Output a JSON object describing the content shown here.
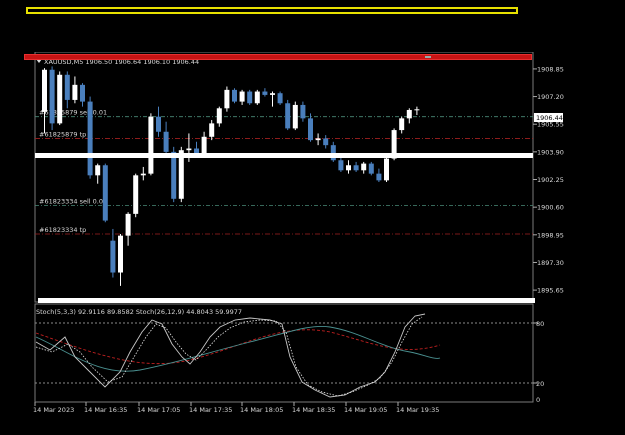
{
  "header": {
    "symbol_line": "XAUUSD,M5  1906.50 1906.64 1906.10 1906.44"
  },
  "price_axis": {
    "ticks": [
      "1908.85",
      "1907.20",
      "1905.55",
      "1903.90",
      "1902.25",
      "1900.60",
      "1898.95",
      "1897.30",
      "1895.65"
    ],
    "current_price": "1906.44"
  },
  "order_lines": [
    {
      "label": "#61825879 sell 0.01",
      "kind": "sell"
    },
    {
      "label": "#61825879 tp",
      "kind": "tp"
    },
    {
      "label": "#61823334 sell 0.01",
      "kind": "sell"
    },
    {
      "label": "#61823334 tp",
      "kind": "tp"
    }
  ],
  "indicator": {
    "label": "Stoch(5,3,3) 92.9116 89.8582  Stoch(26,12,9) 44.8043 59.9977",
    "levels": [
      "80",
      "20",
      "0"
    ]
  },
  "time_axis": [
    "14 Mar 2023",
    "14 Mar 16:35",
    "14 Mar 17:05",
    "14 Mar 17:35",
    "14 Mar 18:05",
    "14 Mar 18:35",
    "14 Mar 19:05",
    "14 Mar 19:35"
  ],
  "colors": {
    "bull": "#ffffff",
    "bear": "#4a7fbd",
    "sell_line": "#4a8a78",
    "tp_line": "#a02020",
    "stoch_fast": "#c8c8c8",
    "stoch_slow_main": "#4a9090",
    "stoch_slow_signal": "#c02020"
  },
  "chart_data": {
    "type": "candlestick",
    "timeframe": "M5",
    "candles_ohlc": [
      [
        1906.3,
        1908.9,
        1905.0,
        1908.8
      ],
      [
        1908.8,
        1909.0,
        1905.2,
        1905.6
      ],
      [
        1905.6,
        1908.7,
        1905.5,
        1908.5
      ],
      [
        1908.5,
        1908.7,
        1906.5,
        1907.0
      ],
      [
        1907.0,
        1908.4,
        1906.8,
        1907.9
      ],
      [
        1907.9,
        1908.0,
        1906.6,
        1906.9
      ],
      [
        1906.9,
        1907.2,
        1902.3,
        1902.5
      ],
      [
        1902.5,
        1903.2,
        1902.0,
        1903.1
      ],
      [
        1903.1,
        1903.2,
        1899.7,
        1899.8
      ],
      [
        1898.6,
        1899.3,
        1896.4,
        1896.7
      ],
      [
        1896.7,
        1899.0,
        1895.9,
        1898.9
      ],
      [
        1898.9,
        1900.3,
        1898.3,
        1900.2
      ],
      [
        1900.2,
        1902.6,
        1900.0,
        1902.5
      ],
      [
        1902.5,
        1903.0,
        1902.2,
        1902.6
      ],
      [
        1902.6,
        1906.2,
        1902.5,
        1906.0
      ],
      [
        1906.0,
        1906.6,
        1904.8,
        1905.1
      ],
      [
        1905.1,
        1905.7,
        1903.7,
        1903.9
      ],
      [
        1903.9,
        1904.2,
        1900.9,
        1901.1
      ],
      [
        1901.1,
        1904.2,
        1900.9,
        1904.0
      ],
      [
        1904.0,
        1905.0,
        1903.3,
        1904.1
      ],
      [
        1904.1,
        1904.5,
        1903.6,
        1903.8
      ],
      [
        1903.8,
        1905.1,
        1903.7,
        1904.8
      ],
      [
        1904.8,
        1905.8,
        1904.6,
        1905.6
      ],
      [
        1905.6,
        1906.6,
        1905.4,
        1906.5
      ],
      [
        1906.5,
        1907.8,
        1906.3,
        1907.6
      ],
      [
        1907.6,
        1907.7,
        1906.8,
        1906.9
      ],
      [
        1906.9,
        1907.6,
        1906.7,
        1907.5
      ],
      [
        1907.5,
        1907.6,
        1906.7,
        1906.8
      ],
      [
        1906.8,
        1907.6,
        1906.7,
        1907.5
      ],
      [
        1907.5,
        1907.7,
        1907.2,
        1907.3
      ],
      [
        1907.3,
        1907.5,
        1906.6,
        1907.4
      ],
      [
        1907.4,
        1907.5,
        1906.7,
        1906.8
      ],
      [
        1906.8,
        1907.0,
        1905.2,
        1905.3
      ],
      [
        1905.3,
        1906.9,
        1905.2,
        1906.7
      ],
      [
        1906.7,
        1906.9,
        1905.7,
        1905.9
      ],
      [
        1905.9,
        1906.2,
        1904.5,
        1904.6
      ],
      [
        1904.6,
        1905.0,
        1904.3,
        1904.7
      ],
      [
        1904.7,
        1904.9,
        1904.1,
        1904.3
      ],
      [
        1904.3,
        1904.5,
        1903.3,
        1903.4
      ],
      [
        1903.4,
        1903.6,
        1902.7,
        1902.8
      ],
      [
        1902.8,
        1903.4,
        1902.6,
        1903.1
      ],
      [
        1903.1,
        1903.3,
        1902.7,
        1902.8
      ],
      [
        1902.8,
        1903.3,
        1902.6,
        1903.2
      ],
      [
        1903.2,
        1903.3,
        1902.5,
        1902.6
      ],
      [
        1902.6,
        1902.9,
        1902.1,
        1902.2
      ],
      [
        1902.2,
        1903.7,
        1902.1,
        1903.5
      ],
      [
        1903.5,
        1905.3,
        1903.4,
        1905.2
      ],
      [
        1905.2,
        1906.0,
        1905.0,
        1905.9
      ],
      [
        1905.9,
        1906.5,
        1905.6,
        1906.4
      ],
      [
        1906.4,
        1906.6,
        1906.1,
        1906.44
      ]
    ],
    "order_levels": [
      1906.0,
      1904.7,
      1900.7,
      1899.0
    ],
    "ylim": [
      1895.0,
      1909.8
    ]
  }
}
